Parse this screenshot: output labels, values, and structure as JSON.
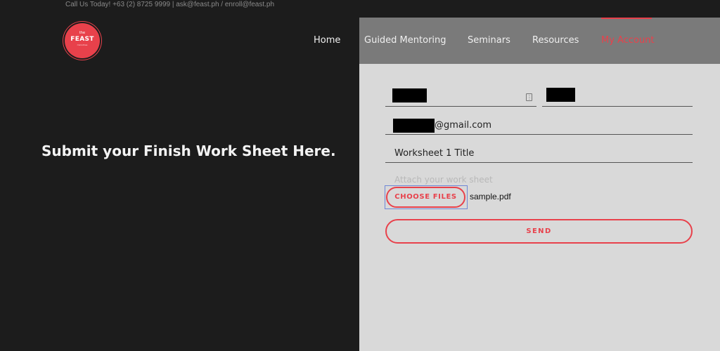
{
  "topbar": {
    "contact": "Call Us Today! +63 (2) 8725 9999  |  ask@feast.ph / enroll@feast.ph"
  },
  "logo": {
    "the": "the",
    "word": "FEAST",
    "sub": "ministries"
  },
  "nav": {
    "items": [
      {
        "label": "Home"
      },
      {
        "label": "Guided Mentoring"
      },
      {
        "label": "Seminars"
      },
      {
        "label": "Resources"
      },
      {
        "label": "My Account"
      }
    ],
    "active_index": 4
  },
  "main": {
    "headline": "Submit your Finish Work Sheet Here."
  },
  "form": {
    "email_suffix": "@gmail.com",
    "worksheet_title": "Worksheet 1 Title",
    "attach_label": "Attach your work sheet",
    "choose_files_label": "CHOOSE FILES",
    "file_name": "sample.pdf",
    "send_label": "SEND"
  },
  "colors": {
    "accent": "#e8414b",
    "background": "#1c1c1c",
    "panel": "#d9d9d9",
    "panel_header": "#7a7a7a"
  }
}
